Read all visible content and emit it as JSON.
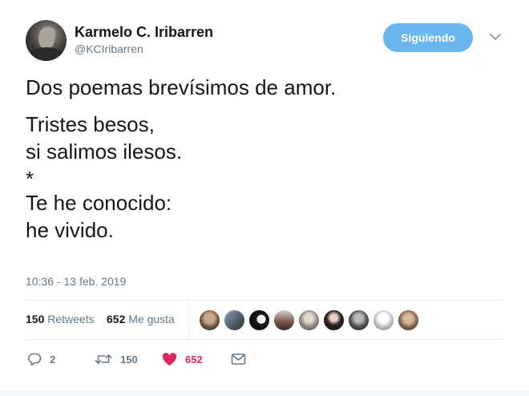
{
  "tweet": {
    "author": {
      "display_name": "Karmelo C. Iribarren",
      "handle": "@KCIribarren"
    },
    "follow_button_label": "Siguiendo",
    "text_lines": [
      "Dos poemas brevísimos de amor.",
      "Tristes besos,",
      "si salimos ilesos.",
      "*",
      "Te he conocido:",
      "he vivido."
    ],
    "timestamp": "10:36 - 13 feb. 2019",
    "stats": {
      "retweets_count": "150",
      "retweets_label": "Retweets",
      "likes_count": "652",
      "likes_label": "Me gusta"
    },
    "likers_count": 9,
    "actions": {
      "reply_count": "2",
      "retweet_count": "150",
      "like_count": "652"
    },
    "colors": {
      "accent": "#6cb6f0",
      "like": "#e0245e",
      "muted": "#657786"
    }
  }
}
